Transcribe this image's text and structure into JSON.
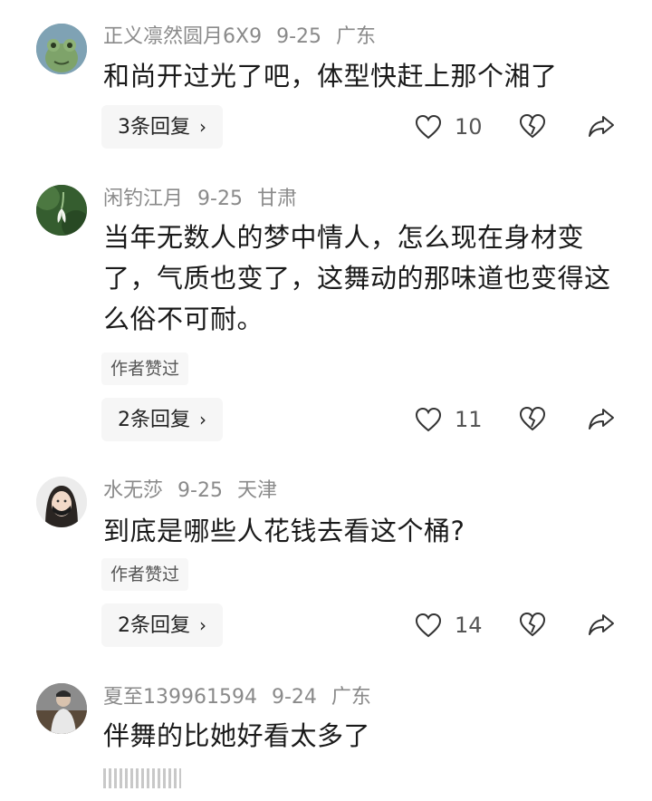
{
  "comments": [
    {
      "username": "正义凛然圆月6X9",
      "date": "9-25",
      "location": "广东",
      "text": "和尚开过光了吧，体型快赶上那个湘了",
      "author_liked": "",
      "replies": "3条回复",
      "likes": "10"
    },
    {
      "username": "闲钓江月",
      "date": "9-25",
      "location": "甘肃",
      "text": "当年无数人的梦中情人，怎么现在身材变了，气质也变了，这舞动的那味道也变得这么俗不可耐。",
      "author_liked": "作者赞过",
      "replies": "2条回复",
      "likes": "11"
    },
    {
      "username": "水无莎",
      "date": "9-25",
      "location": "天津",
      "text": "到底是哪些人花钱去看这个桶?",
      "author_liked": "作者赞过",
      "replies": "2条回复",
      "likes": "14"
    },
    {
      "username": "夏至139961594",
      "date": "9-24",
      "location": "广东",
      "text": "伴舞的比她好看太多了",
      "author_liked": "",
      "replies": "",
      "likes": ""
    }
  ],
  "icons": {
    "like": "heart-outline-icon",
    "dislike": "broken-heart-icon",
    "share": "share-arrow-icon",
    "reply_chevron": "chevron-right-icon"
  },
  "colors": {
    "meta_text": "#8a8a8a",
    "body_text": "#1a1a1a",
    "button_bg": "#f6f6f6"
  }
}
